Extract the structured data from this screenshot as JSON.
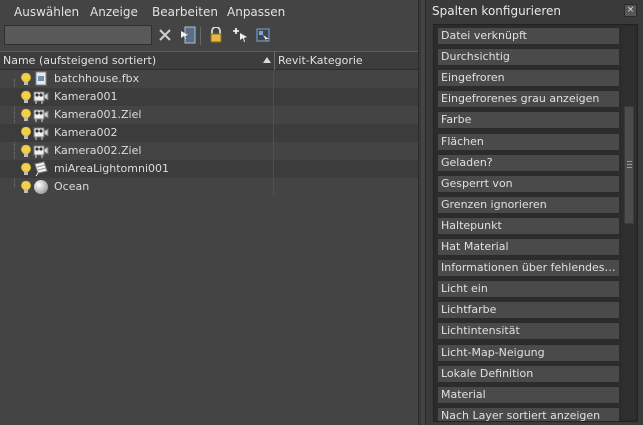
{
  "menu": [
    "Auswählen",
    "Anzeige",
    "Bearbeiten",
    "Anpassen"
  ],
  "search": {
    "value": "",
    "placeholder": ""
  },
  "toolbar_icons": [
    "clear-x-icon",
    "select-arrow-icon",
    "lock-icon",
    "add-select-icon",
    "hierarchy-select-icon"
  ],
  "columns": {
    "name": "Name (aufsteigend sortiert)",
    "revit": "Revit-Kategorie"
  },
  "tree_rows": [
    {
      "label": "batchhouse.fbx",
      "icon": "file-icon"
    },
    {
      "label": "Kamera001",
      "icon": "camera-icon"
    },
    {
      "label": "Kamera001.Ziel",
      "icon": "camera-icon"
    },
    {
      "label": "Kamera002",
      "icon": "camera-icon"
    },
    {
      "label": "Kamera002.Ziel",
      "icon": "camera-icon"
    },
    {
      "label": "miAreaLightomni001",
      "icon": "light-icon"
    },
    {
      "label": "Ocean",
      "icon": "sphere-icon"
    }
  ],
  "panel": {
    "title": "Spalten konfigurieren",
    "close_label": "×",
    "items": [
      "Datei verknüpft",
      "Durchsichtig",
      "Eingefroren",
      "Eingefrorenes grau anzeigen",
      "Farbe",
      "Flächen",
      "Geladen?",
      "Gesperrt von",
      "Grenzen ignorieren",
      "Haltepunkt",
      "Hat Material",
      "Informationen über fehlendes Plug-in",
      "Licht ein",
      "Lichtfarbe",
      "Lichtintensität",
      "Licht-Map-Neigung",
      "Lokale Definition",
      "Material",
      "Nach Layer sortiert anzeigen"
    ]
  },
  "colors": {
    "background": "#444444",
    "panel": "#3a3a3a",
    "item": "#4a4a4a",
    "bulb": "#f2d14a"
  }
}
